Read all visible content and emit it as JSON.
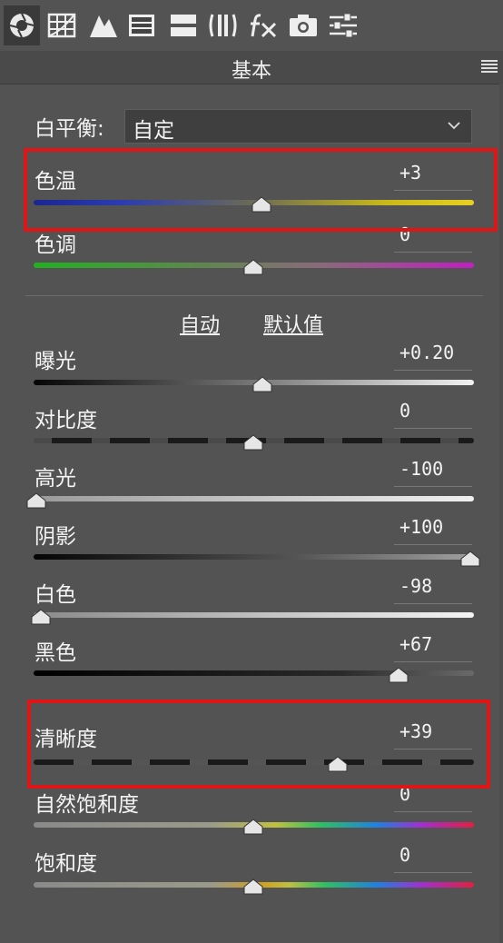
{
  "panel": {
    "title": "基本"
  },
  "toolbar": {
    "tools": [
      {
        "icon": "aperture-icon",
        "active": true
      },
      {
        "icon": "tone-curve-grid-icon"
      },
      {
        "icon": "mountains-icon"
      },
      {
        "icon": "hsl-panel-icon"
      },
      {
        "icon": "split-toning-icon"
      },
      {
        "icon": "lens-corrections-icon"
      },
      {
        "icon": "fx-effects-icon"
      },
      {
        "icon": "camera-calibration-icon"
      },
      {
        "icon": "presets-sliders-icon"
      }
    ]
  },
  "white_balance": {
    "label": "白平衡:",
    "selected": "自定"
  },
  "tone_links": {
    "auto": "自动",
    "default": "默认值"
  },
  "sliders": [
    {
      "key": "temp",
      "label": "色温",
      "value": "+3",
      "fraction": 0.518
    },
    {
      "key": "tint",
      "label": "色调",
      "value": "0",
      "fraction": 0.5
    },
    {
      "key": "exposure",
      "label": "曝光",
      "value": "+0.20",
      "fraction": 0.52
    },
    {
      "key": "contrast",
      "label": "对比度",
      "value": "0",
      "fraction": 0.5
    },
    {
      "key": "highlights",
      "label": "高光",
      "value": "-100",
      "fraction": 0.0
    },
    {
      "key": "shadows",
      "label": "阴影",
      "value": "+100",
      "fraction": 1.0
    },
    {
      "key": "whites",
      "label": "白色",
      "value": "-98",
      "fraction": 0.01
    },
    {
      "key": "blacks",
      "label": "黑色",
      "value": "+67",
      "fraction": 0.835
    },
    {
      "key": "clarity",
      "label": "清晰度",
      "value": "+39",
      "fraction": 0.695
    },
    {
      "key": "vibrance",
      "label": "自然饱和度",
      "value": "0",
      "fraction": 0.5
    },
    {
      "key": "saturation",
      "label": "饱和度",
      "value": "0",
      "fraction": 0.5
    }
  ],
  "colors": {
    "highlight_box": "#e01616",
    "background": "#535353"
  }
}
